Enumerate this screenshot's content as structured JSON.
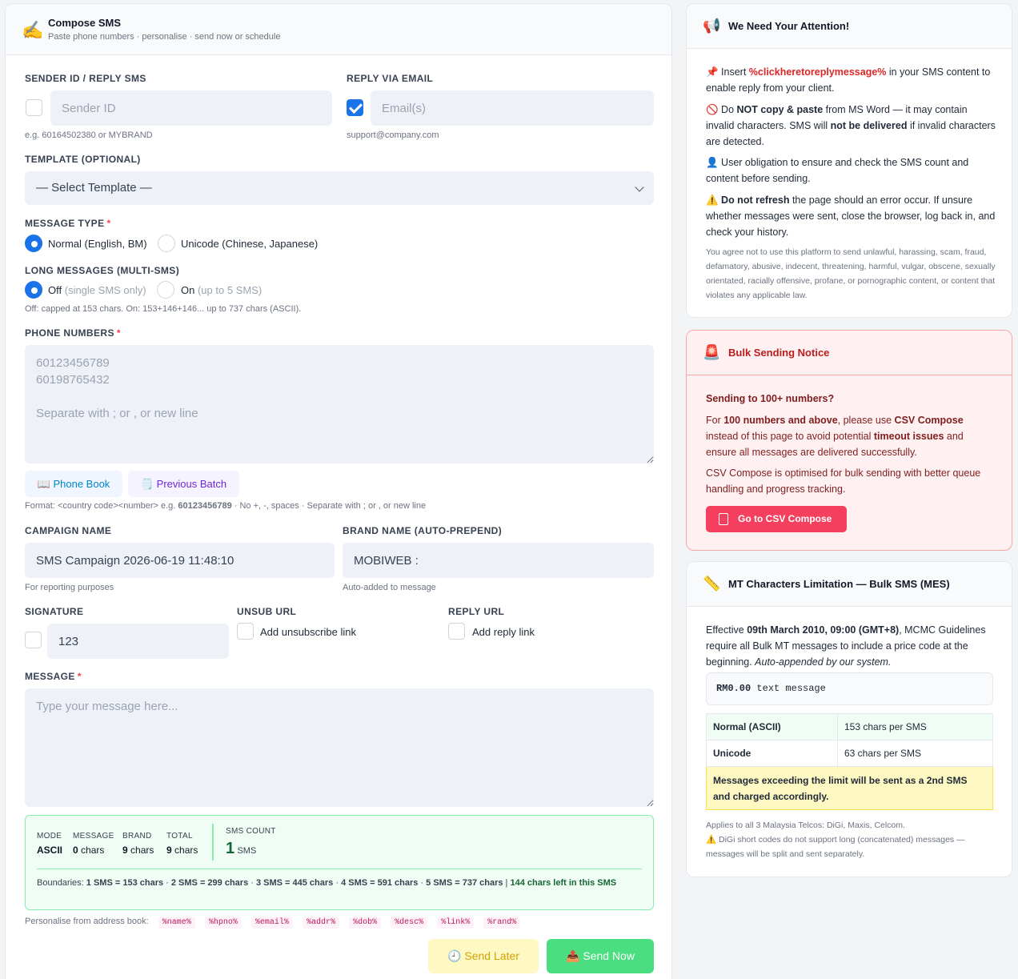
{
  "compose": {
    "title": "Compose SMS",
    "subtitle": "Paste phone numbers · personalise · send now or schedule",
    "sender_label": "SENDER ID / REPLY SMS",
    "sender_placeholder": "Sender ID",
    "sender_help": "e.g. 60164502380 or MYBRAND",
    "email_label": "REPLY VIA EMAIL",
    "email_placeholder": "Email(s)",
    "email_help": "support@company.com",
    "template_label": "TEMPLATE (OPTIONAL)",
    "template_selected": "— Select Template —",
    "msgtype_label": "MESSAGE TYPE",
    "req_mark": "*",
    "msgtype_normal": "Normal (English, BM)",
    "msgtype_unicode": "Unicode (Chinese, Japanese)",
    "long_label": "LONG MESSAGES (MULTI-SMS)",
    "long_off": "Off",
    "long_off_note": "(single SMS only)",
    "long_on": "On",
    "long_on_note": "(up to 5 SMS)",
    "long_help": "Off: capped at 153 chars. On: 153+146+146... up to 737 chars (ASCII).",
    "phone_label": "PHONE NUMBERS",
    "phone_placeholder": "60123456789\n60198765432\n\nSeparate with ; or , or new line",
    "phonebook_btn": "📖 Phone Book",
    "prevbatch_btn": "🗒️ Previous Batch",
    "format_pre": "Format: <country code><number> e.g. ",
    "format_example": "60123456789",
    "format_post": " · No +, -, spaces · Separate with ; or , or new line",
    "campaign_label": "CAMPAIGN NAME",
    "campaign_value": "SMS Campaign 2026-06-19 11:48:10",
    "campaign_help": "For reporting purposes",
    "brand_label": "BRAND NAME (AUTO-PREPEND)",
    "brand_value": "MOBIWEB :",
    "brand_help": "Auto-added to message",
    "signature_label": "SIGNATURE",
    "signature_value": "123",
    "unsub_label": "UNSUB URL",
    "unsub_text": "Add unsubscribe link",
    "reply_label": "REPLY URL",
    "reply_text": "Add reply link",
    "message_label": "MESSAGE",
    "message_placeholder": "Type your message here...",
    "personalise_label": "Personalise from address book:",
    "tags": [
      "%name%",
      "%hpno%",
      "%email%",
      "%addr%",
      "%dob%",
      "%desc%",
      "%link%",
      "%rand%"
    ],
    "send_later": "🕘 Send Later",
    "send_now": "📤 Send Now"
  },
  "stats": {
    "mode_k": "MODE",
    "mode_v": "ASCII",
    "message_k": "MESSAGE",
    "message_num": "0",
    "message_unit": "chars",
    "brand_k": "BRAND",
    "brand_num": "9",
    "brand_unit": "chars",
    "total_k": "TOTAL",
    "total_num": "9",
    "total_unit": "chars",
    "count_k": "SMS COUNT",
    "count_num": "1",
    "count_unit": "SMS",
    "bound_label": "Boundaries:",
    "bounds": [
      "1 SMS = 153 chars",
      "2 SMS = 299 chars",
      "3 SMS = 445 chars",
      "4 SMS = 591 chars",
      "5 SMS = 737 chars"
    ],
    "left": "144 chars left in this SMS"
  },
  "attention": {
    "title": "We Need Your Attention!",
    "p1_pre": "Insert ",
    "p1_hl": "%clickheretoreplymessage%",
    "p1_post": " in your SMS content to enable reply from your client.",
    "p2_a": "Do ",
    "p2_b": "NOT copy & paste",
    "p2_c": " from MS Word — it may contain invalid characters. SMS will ",
    "p2_d": "not be delivered",
    "p2_e": " if invalid characters are detected.",
    "p3": "User obligation to ensure and check the SMS count and content before sending.",
    "p4_b": "Do not refresh",
    "p4_post": " the page should an error occur. If unsure whether messages were sent, close the browser, log back in, and check your history.",
    "fine": "You agree not to use this platform to send unlawful, harassing, scam, fraud, defamatory, abusive, indecent, threatening, harmful, vulgar, obscene, sexually orientated, racially offensive, profane, or pornographic content, or content that violates any applicable law."
  },
  "bulk": {
    "title": "Bulk Sending Notice",
    "q": "Sending to 100+ numbers?",
    "p1_a": "For ",
    "p1_b": "100 numbers and above",
    "p1_c": ", please use ",
    "p1_d": "CSV Compose",
    "p1_e": " instead of this page to avoid potential ",
    "p1_f": "timeout issues",
    "p1_g": " and ensure all messages are delivered successfully.",
    "p2": "CSV Compose is optimised for bulk sending with better queue handling and progress tracking.",
    "button": "Go to CSV Compose"
  },
  "limit": {
    "title": "MT Characters Limitation — Bulk SMS (MES)",
    "p_a": "Effective ",
    "p_b": "09th March 2010, 09:00 (GMT+8)",
    "p_c": ", MCMC Guidelines require all Bulk MT messages to include a price code at the beginning. ",
    "p_d": "Auto-appended by our system.",
    "code_b": "RM0.00",
    "code_rest": " text message",
    "rows": [
      {
        "key": "Normal (ASCII)",
        "val": "153 chars per SMS"
      },
      {
        "key": "Unicode",
        "val": "63 chars per SMS"
      }
    ],
    "warn": "Messages exceeding the limit will be sent as a 2nd SMS and charged accordingly.",
    "foot1": "Applies to all 3 Malaysia Telcos: DiGi, Maxis, Celcom.",
    "foot2": "DiGi short codes do not support long (concatenated) messages — messages will be split and sent separately."
  }
}
